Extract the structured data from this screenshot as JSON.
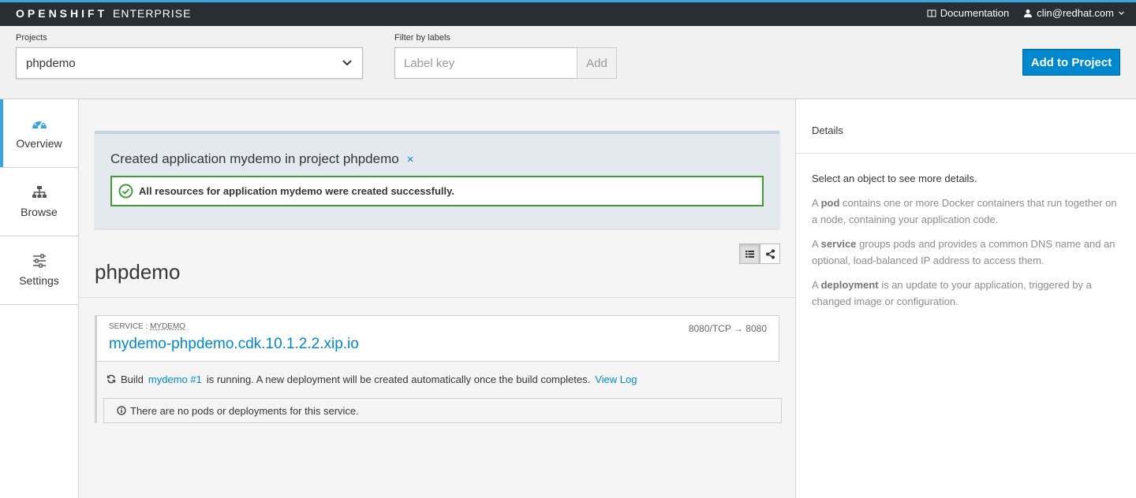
{
  "navbar": {
    "brand_bold": "OPENSHIFT",
    "brand_light": "ENTERPRISE",
    "documentation_label": "Documentation",
    "user_label": "clin@redhat.com"
  },
  "project_bar": {
    "projects_label": "Projects",
    "selected_project": "phpdemo",
    "filter_label": "Filter by labels",
    "label_placeholder": "Label key",
    "add_label": "Add",
    "add_to_project_label": "Add to Project"
  },
  "sidebar": {
    "items": [
      {
        "label": "Overview",
        "icon": "tachometer-icon",
        "active": true
      },
      {
        "label": "Browse",
        "icon": "sitemap-icon",
        "active": false
      },
      {
        "label": "Settings",
        "icon": "sliders-icon",
        "active": false
      }
    ]
  },
  "alert": {
    "title": "Created application mydemo in project phpdemo",
    "close_glyph": "×",
    "success_message": "All resources for application mydemo were created successfully."
  },
  "main": {
    "project_heading": "phpdemo",
    "service": {
      "label_prefix": "SERVICE : ",
      "name": "MYDEMO",
      "route": "mydemo-phpdemo.cdk.10.1.2.2.xip.io",
      "port_mapping": "8080/TCP → 8080"
    },
    "build": {
      "text_before": "Build",
      "build_link": "mydemo #1",
      "text_after": "is running. A new deployment will be created automatically once the build completes.",
      "view_log_label": "View Log"
    },
    "no_pods_message": "There are no pods or deployments for this service."
  },
  "details": {
    "title": "Details",
    "intro": "Select an object to see more details.",
    "pod_term": "pod",
    "pod_text": "contains one or more Docker containers that run together on a node, containing your application code.",
    "service_term": "service",
    "service_text": "groups pods and provides a common DNS name and an optional, load-balanced IP address to access them.",
    "deployment_term": "deployment",
    "deployment_text": "is an update to your application, triggered by a changed image or configuration.",
    "article": "A"
  },
  "colors": {
    "accent": "#0088ce",
    "success": "#3f9c35",
    "navbar_bg": "#292e34"
  }
}
